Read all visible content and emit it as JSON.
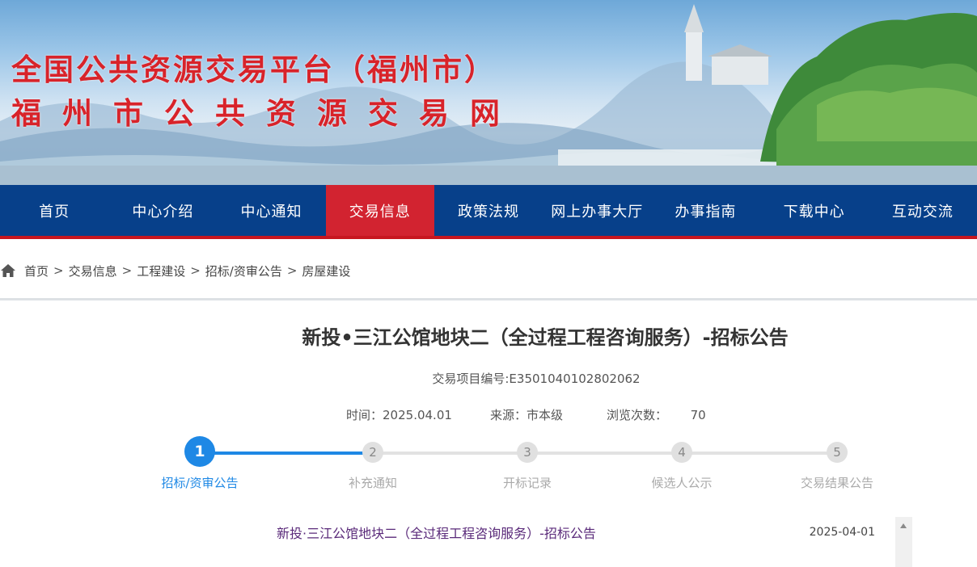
{
  "banner": {
    "title_line1": "全国公共资源交易平台（福州市）",
    "title_line2": "福州市公共资源交易网"
  },
  "nav": {
    "items": [
      {
        "label": "首页"
      },
      {
        "label": "中心介绍"
      },
      {
        "label": "中心通知"
      },
      {
        "label": "交易信息",
        "active": true
      },
      {
        "label": "政策法规"
      },
      {
        "label": "网上办事大厅"
      },
      {
        "label": "办事指南"
      },
      {
        "label": "下载中心"
      },
      {
        "label": "互动交流"
      }
    ],
    "active_color": "#d22330",
    "bar_color": "#07408a"
  },
  "breadcrumb": {
    "icon": "home-icon",
    "separator": ">",
    "items": [
      "首页",
      "交易信息",
      "工程建设",
      "招标/资审公告",
      "房屋建设"
    ]
  },
  "article": {
    "title": "新投•三江公馆地块二（全过程工程咨询服务）-招标公告",
    "project_no": "交易项目编号:E3501040102802062",
    "time_label": "时间：",
    "time_value": "2025.04.01",
    "source_label": "来源：",
    "source_value": "市本级",
    "views_label": "浏览次数：",
    "views_value": "70"
  },
  "steps": {
    "accent_color": "#1e88e5",
    "items": [
      {
        "num": "1",
        "label": "招标/资审公告",
        "active": true
      },
      {
        "num": "2",
        "label": "补充通知"
      },
      {
        "num": "3",
        "label": "开标记录"
      },
      {
        "num": "4",
        "label": "候选人公示"
      },
      {
        "num": "5",
        "label": "交易结果公告"
      }
    ]
  },
  "list": {
    "items": [
      {
        "title": "新投·三江公馆地块二（全过程工程咨询服务）-招标公告",
        "date": "2025-04-01"
      }
    ]
  }
}
